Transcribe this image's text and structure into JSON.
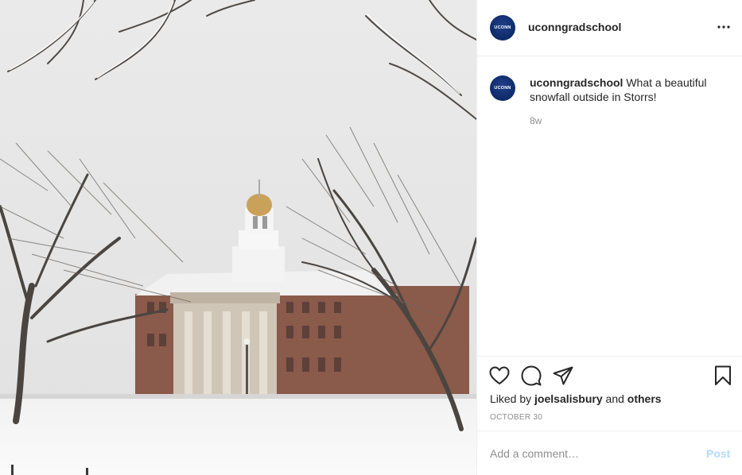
{
  "post": {
    "photo_alt": "Snowy campus building",
    "header": {
      "username": "uconngradschool",
      "avatar_text": "UCONN"
    },
    "caption": {
      "username": "uconngradschool",
      "text": "What a beautiful snowfall outside in Storrs!",
      "time": "8w"
    },
    "likes": {
      "prefix": "Liked by",
      "user": "joelsalisbury",
      "conjunction": "and",
      "others": "others"
    },
    "date": "OCTOBER 30",
    "comment": {
      "placeholder": "Add a comment…",
      "post_label": "Post"
    },
    "icons": {
      "more": "more-options-icon",
      "like": "heart-icon",
      "comment": "comment-icon",
      "share": "share-icon",
      "save": "bookmark-icon"
    },
    "colors": {
      "text": "#262626",
      "muted": "#8e8e8e",
      "post_disabled": "#b3dbff",
      "avatar": "#0e2a68"
    }
  }
}
